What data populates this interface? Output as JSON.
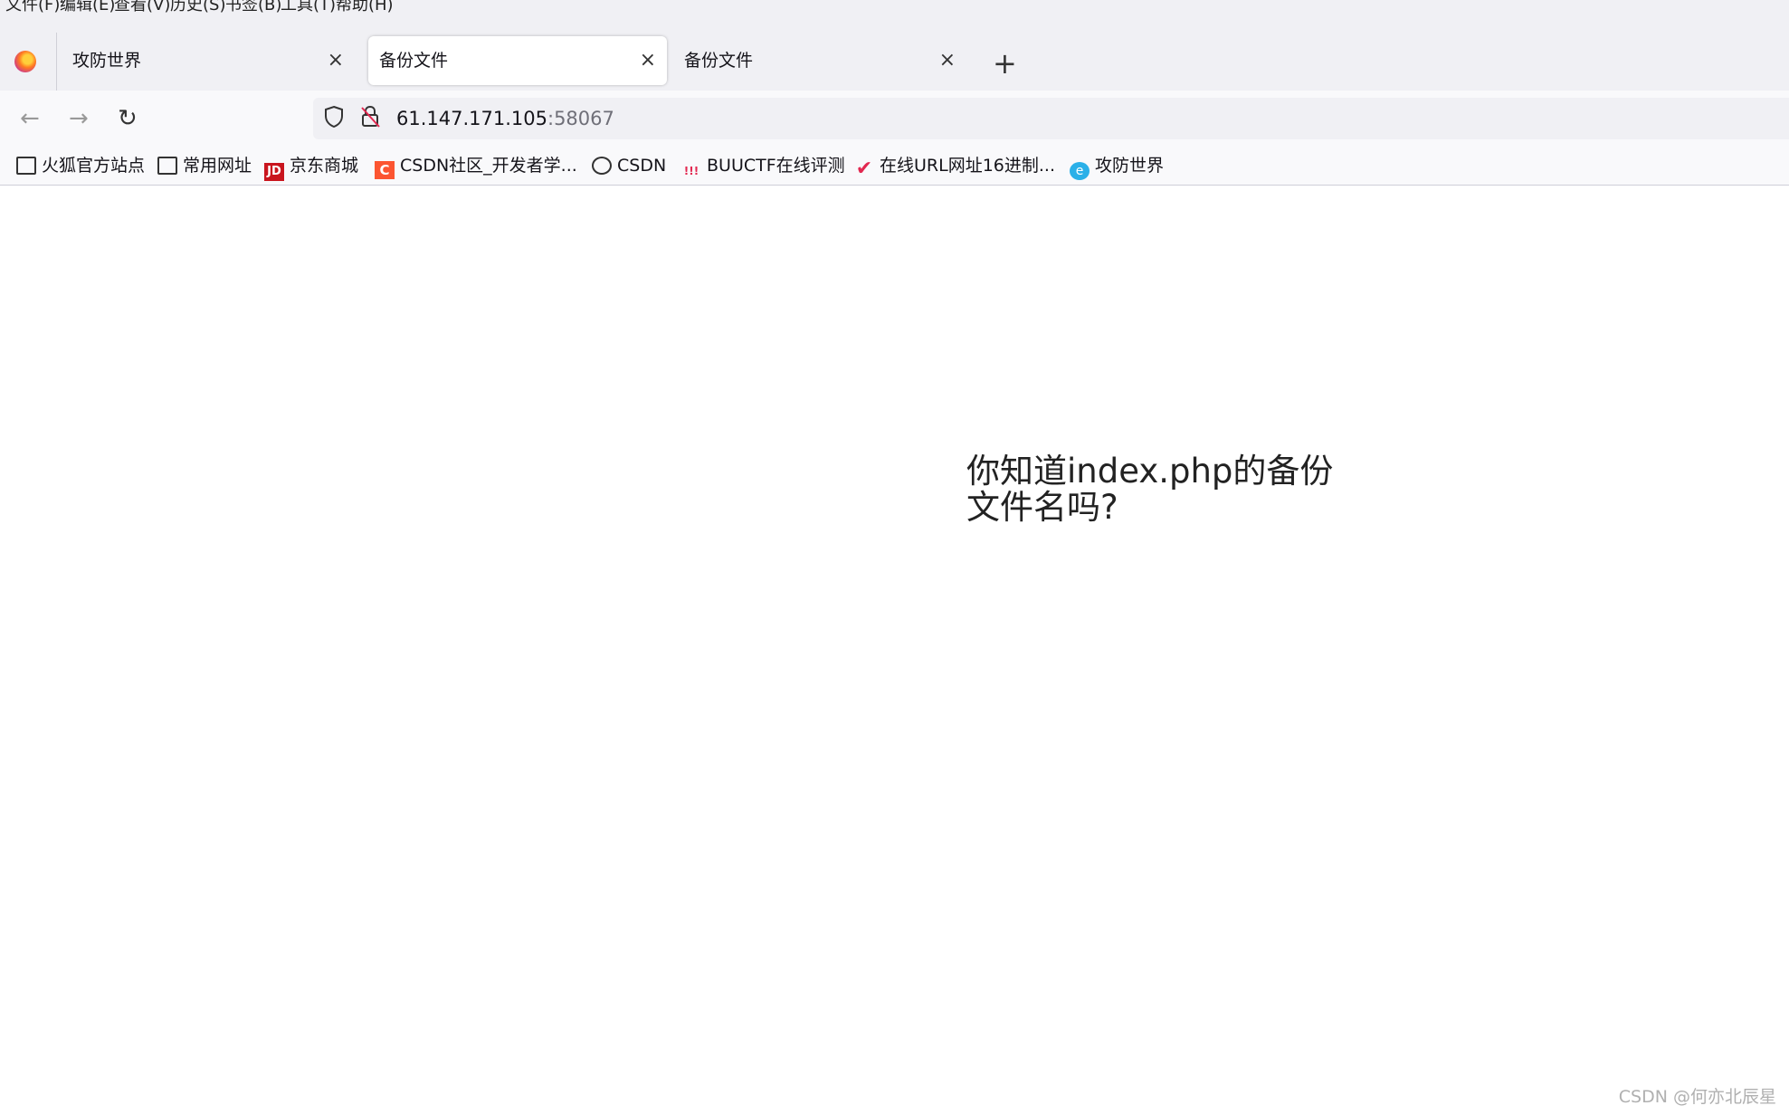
{
  "menubar": {
    "items": [
      "文件(F)",
      "编辑(E)",
      "查看(V)",
      "历史(S)",
      "书签(B)",
      "工具(T)",
      "帮助(H)"
    ]
  },
  "tabs": [
    {
      "label": "攻防世界",
      "active": false
    },
    {
      "label": "备份文件",
      "active": true
    },
    {
      "label": "备份文件",
      "active": false
    }
  ],
  "tab_close_glyph": "×",
  "new_tab_glyph": "+",
  "nav": {
    "back_glyph": "←",
    "forward_glyph": "→",
    "reload_glyph": "↻"
  },
  "urlbar": {
    "host": "61.147.171.105",
    "port": ":58067"
  },
  "bookmarks": [
    {
      "label": "火狐官方站点",
      "icon": "folder-icon"
    },
    {
      "label": "常用网址",
      "icon": "folder-icon"
    },
    {
      "label": "京东商城",
      "icon": "jd-icon",
      "glyph": "JD"
    },
    {
      "label": "CSDN社区_开发者学...",
      "icon": "csdn-icon",
      "glyph": "C"
    },
    {
      "label": "CSDN",
      "icon": "globe-icon"
    },
    {
      "label": "BUUCTF在线评测",
      "icon": "buuctf-icon",
      "glyph": "!!!"
    },
    {
      "label": "在线URL网址16进制...",
      "icon": "checkmark-icon",
      "glyph": "✔"
    },
    {
      "label": "攻防世界",
      "icon": "adworld-icon",
      "glyph": "e"
    }
  ],
  "page": {
    "question": "你知道index.php的备份文件名吗?"
  },
  "watermark": "CSDN @何亦北辰星",
  "colors": {
    "chrome_bg": "#f0f0f4",
    "toolbar_bg": "#f9f9fb",
    "accent_red": "#e22850",
    "jd_red": "#c9151e",
    "csdn_orange": "#fc5531"
  }
}
